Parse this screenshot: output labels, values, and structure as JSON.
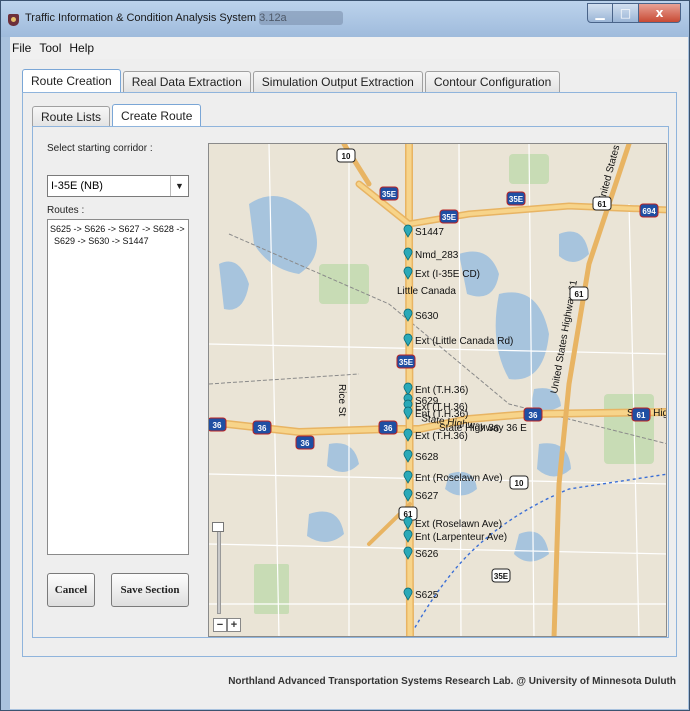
{
  "window": {
    "title": "Traffic Information & Condition Analysis System 3.12a",
    "close_glyph": "x"
  },
  "menu": [
    "File",
    "Tool",
    "Help"
  ],
  "main_tabs": [
    "Route Creation",
    "Real Data Extraction",
    "Simulation Output Extraction",
    "Contour Configuration"
  ],
  "sub_tabs": [
    "Route Lists",
    "Create Route"
  ],
  "left": {
    "corridor_label": "Select starting corridor :",
    "corridor_value": "I-35E (NB)",
    "routes_label": "Routes :",
    "routes_line1": "S625 -> S626 -> S627 -> S628 ->",
    "routes_line2": "S629 -> S630 -> S1447",
    "cancel_label": "Cancel",
    "save_label": "Save Section"
  },
  "map": {
    "zoom_in": "+",
    "zoom_out": "−",
    "place_label": "Little Canada",
    "street_label": "Rice St",
    "highway_shields": [
      "10",
      "35E",
      "35E",
      "35E",
      "61",
      "694",
      "61",
      "35E",
      "36",
      "36",
      "36",
      "36",
      "36",
      "61",
      "10",
      "61",
      "35E"
    ],
    "highway_labels": [
      "United States Highway 61",
      "United States Highway 61",
      "State Highway 36",
      "State Highway 36 E",
      "State Highway 36"
    ],
    "stops": [
      "S1447",
      "Nmd_283",
      "Ext (I-35E CD)",
      "S630",
      "Ext (Little Canada Rd)",
      "Ent (T.H.36)",
      "S629",
      "Ext (T.H.36)",
      "Ent (T.H.36)",
      "Ext (T.H.36)",
      "S628",
      "Ent (Roselawn Ave)",
      "S627",
      "Ext (Roselawn Ave)",
      "Ent (Larpenteur Ave)",
      "S626",
      "S625"
    ]
  },
  "footer": "Northland Advanced Transportation Systems Research Lab. @ University of Minnesota Duluth"
}
